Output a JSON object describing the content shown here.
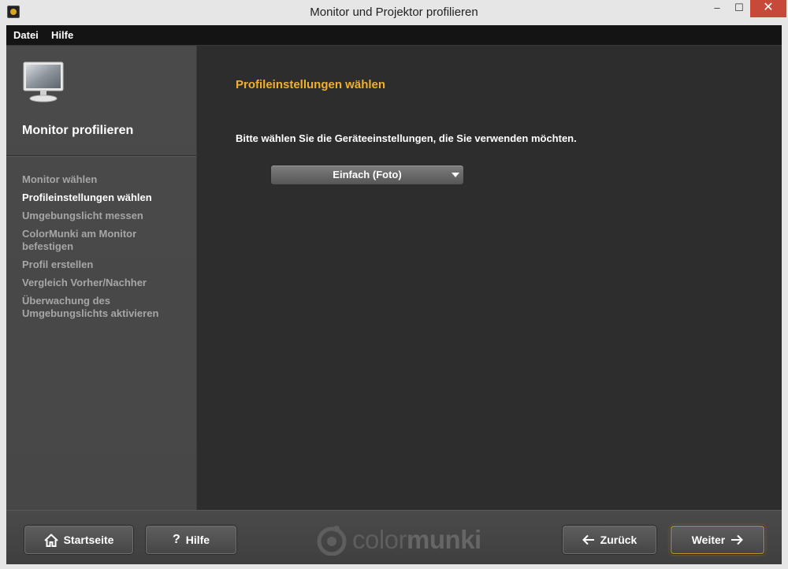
{
  "window": {
    "title": "Monitor und Projektor profilieren",
    "minimize": "–",
    "maximize": "☐",
    "close": "✕"
  },
  "menu": {
    "items": [
      "Datei",
      "Hilfe"
    ]
  },
  "sidebar": {
    "heading": "Monitor profilieren",
    "steps": [
      {
        "label": "Monitor wählen",
        "active": false
      },
      {
        "label": "Profileinstellungen wählen",
        "active": true
      },
      {
        "label": "Umgebungslicht messen",
        "active": false
      },
      {
        "label": "ColorMunki am Monitor befestigen",
        "active": false
      },
      {
        "label": "Profil erstellen",
        "active": false
      },
      {
        "label": "Vergleich Vorher/Nachher",
        "active": false
      },
      {
        "label": "Überwachung des Umgebungslichts aktivieren",
        "active": false
      }
    ]
  },
  "main": {
    "title": "Profileinstellungen wählen",
    "instruction": "Bitte wählen Sie die Geräteeinstellungen, die Sie verwenden möchten.",
    "dropdown": {
      "selected": "Einfach (Foto)"
    }
  },
  "footer": {
    "start_label": "Startseite",
    "help_label": "Hilfe",
    "back_label": "Zurück",
    "next_label": "Weiter",
    "logo": {
      "text_light": "color",
      "text_bold": "munki"
    }
  },
  "colors": {
    "accent": "#f0b02c",
    "background": "#2d2d2d",
    "sidebar": "#4a4a4a"
  }
}
